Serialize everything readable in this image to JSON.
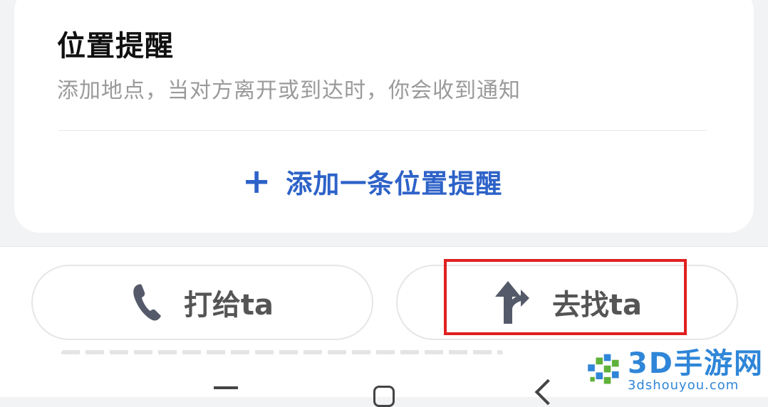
{
  "card": {
    "title": "位置提醒",
    "subtitle": "添加地点，当对方离开或到达时，你会收到通知",
    "add_button": {
      "icon": "plus-icon",
      "label": "添加一条位置提醒"
    }
  },
  "actions": {
    "call": {
      "icon": "phone-icon",
      "label": "打给ta"
    },
    "go": {
      "icon": "navigation-arrow-icon",
      "label": "去找ta"
    }
  },
  "watermark": {
    "main": "3D手游网",
    "sub": "3dshouyou.com"
  },
  "colors": {
    "accent": "#2d62c8",
    "highlight": "#e02020",
    "watermark": "#2f86d8"
  }
}
